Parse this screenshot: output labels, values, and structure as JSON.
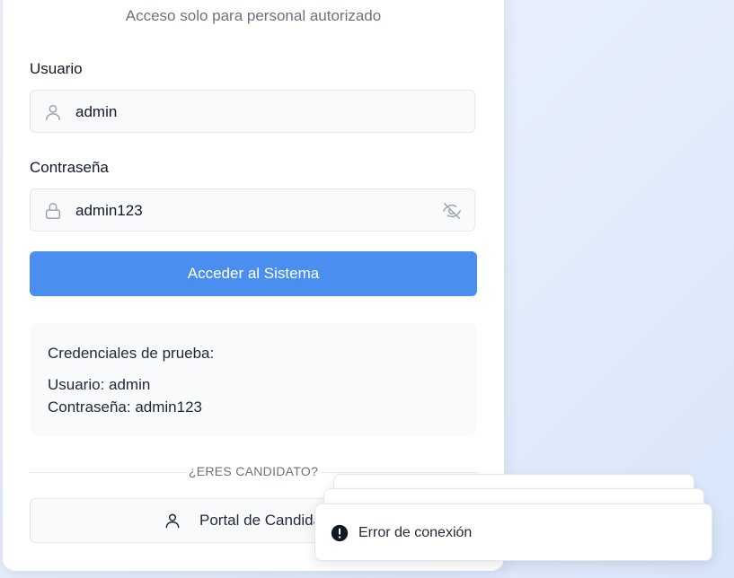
{
  "login": {
    "subtitle": "Acceso solo para personal autorizado",
    "username_label": "Usuario",
    "username_value": "admin",
    "password_label": "Contraseña",
    "password_value": "admin123",
    "submit_label": "Acceder al Sistema"
  },
  "test_credentials": {
    "title": "Credenciales de prueba:",
    "username_line": "Usuario: admin",
    "password_line": "Contraseña: admin123"
  },
  "candidate": {
    "divider_text": "¿ERES CANDIDATO?",
    "portal_label": "Portal de Candidatos"
  },
  "toast": {
    "message": "Error de conexión"
  },
  "icons": {
    "user": "user-icon",
    "lock": "lock-icon",
    "eye_off": "eye-off-icon",
    "error": "alert-circle-icon"
  },
  "colors": {
    "accent": "#4a8ff0",
    "background": "#e3ecfb"
  }
}
